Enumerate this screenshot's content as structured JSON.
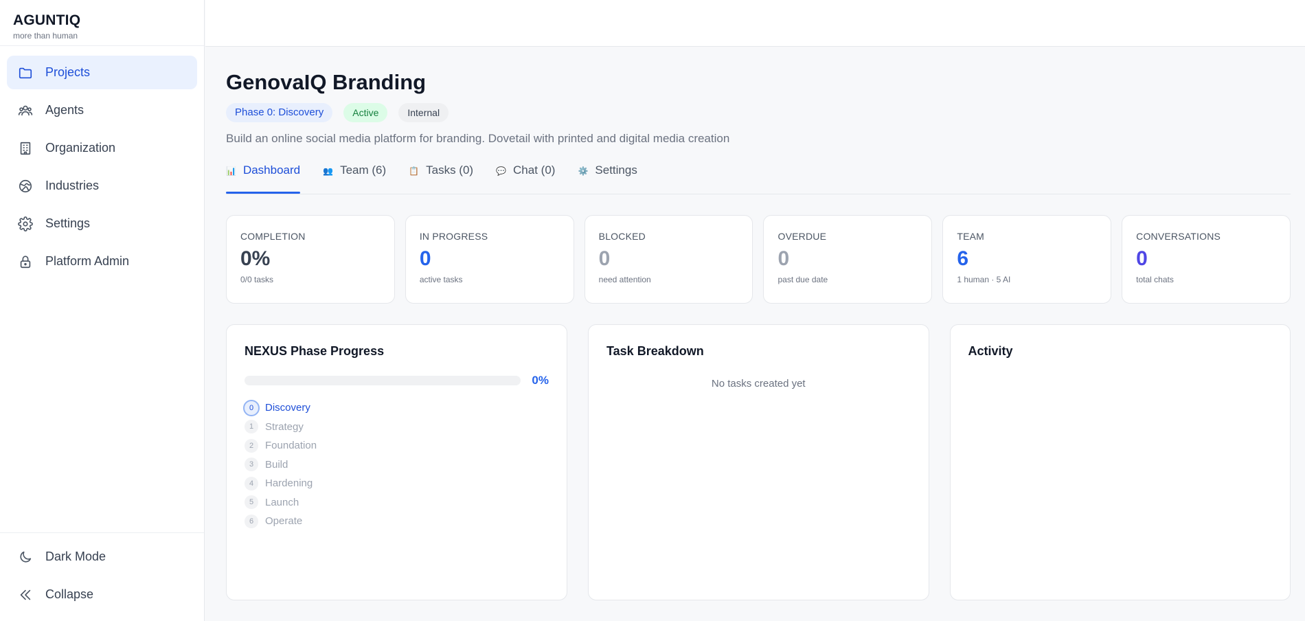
{
  "brand": {
    "name": "AGUNTIQ",
    "tagline": "more than human"
  },
  "sidebar": {
    "items": [
      {
        "label": "Projects",
        "icon": "folder-icon",
        "active": true
      },
      {
        "label": "Agents",
        "icon": "users-icon",
        "active": false
      },
      {
        "label": "Organization",
        "icon": "building-icon",
        "active": false
      },
      {
        "label": "Industries",
        "icon": "globe-icon",
        "active": false
      },
      {
        "label": "Settings",
        "icon": "gear-icon",
        "active": false
      },
      {
        "label": "Platform Admin",
        "icon": "lock-icon",
        "active": false
      }
    ],
    "bottom": [
      {
        "label": "Dark Mode",
        "icon": "moon-icon"
      },
      {
        "label": "Collapse",
        "icon": "double-chevron-left-icon"
      }
    ]
  },
  "project": {
    "title": "GenovaIQ Branding",
    "badges": {
      "phase": "Phase 0: Discovery",
      "status": "Active",
      "visibility": "Internal"
    },
    "description": "Build an online social media platform for branding. Dovetail with printed and digital media creation"
  },
  "tabs": [
    {
      "label": "Dashboard",
      "icon": "📊",
      "active": true
    },
    {
      "label": "Team (6)",
      "icon": "👥",
      "active": false
    },
    {
      "label": "Tasks (0)",
      "icon": "📋",
      "active": false
    },
    {
      "label": "Chat (0)",
      "icon": "💬",
      "active": false
    },
    {
      "label": "Settings",
      "icon": "⚙️",
      "active": false
    }
  ],
  "stats": [
    {
      "label": "COMPLETION",
      "value": "0%",
      "sub": "0/0 tasks",
      "color": "#374151"
    },
    {
      "label": "IN PROGRESS",
      "value": "0",
      "sub": "active tasks",
      "color": "#2563eb"
    },
    {
      "label": "BLOCKED",
      "value": "0",
      "sub": "need attention",
      "color": "#9ca3af"
    },
    {
      "label": "OVERDUE",
      "value": "0",
      "sub": "past due date",
      "color": "#9ca3af"
    },
    {
      "label": "TEAM",
      "value": "6",
      "sub": "1 human · 5 AI",
      "color": "#2563eb"
    },
    {
      "label": "CONVERSATIONS",
      "value": "0",
      "sub": "total chats",
      "color": "#4f46e5"
    }
  ],
  "phase_progress": {
    "title": "NEXUS Phase Progress",
    "percent_label": "0%",
    "percent": 0,
    "phases": [
      {
        "num": "0",
        "label": "Discovery",
        "current": true
      },
      {
        "num": "1",
        "label": "Strategy",
        "current": false
      },
      {
        "num": "2",
        "label": "Foundation",
        "current": false
      },
      {
        "num": "3",
        "label": "Build",
        "current": false
      },
      {
        "num": "4",
        "label": "Hardening",
        "current": false
      },
      {
        "num": "5",
        "label": "Launch",
        "current": false
      },
      {
        "num": "6",
        "label": "Operate",
        "current": false
      }
    ]
  },
  "task_breakdown": {
    "title": "Task Breakdown",
    "empty_text": "No tasks created yet"
  },
  "activity": {
    "title": "Activity"
  }
}
